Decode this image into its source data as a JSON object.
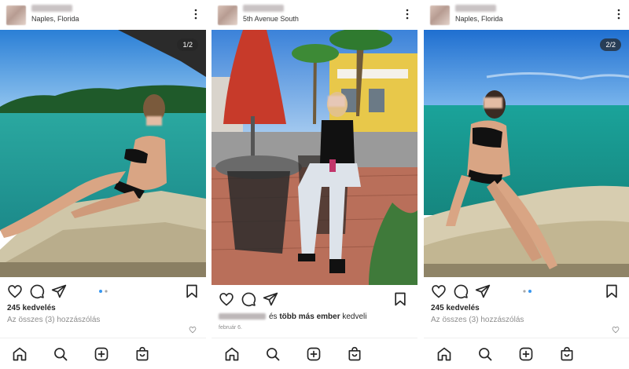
{
  "posts": [
    {
      "location": "Naples, Florida",
      "badge": "1/2",
      "likes": "245 kedvelés",
      "comments": "Az összes (3) hozzászólás"
    },
    {
      "location": "5th Avenue South",
      "likes_suffix": "és ",
      "likes_others": "több más ember",
      "likes_end": " kedveli",
      "date": "február 6."
    },
    {
      "location": "Naples, Florida",
      "badge": "2/2",
      "likes": "245 kedvelés",
      "comments": "Az összes (3) hozzászólás"
    }
  ],
  "icons": {
    "more": "more-vertical-icon",
    "like": "heart-icon",
    "comment": "comment-icon",
    "share": "send-icon",
    "save": "bookmark-icon",
    "home": "home-icon",
    "search": "search-icon",
    "create": "plus-square-icon",
    "shop": "shopping-bag-icon"
  },
  "colors": {
    "carousel_active_dot": "#3897f0",
    "carousel_inactive_dot": "#a8a8a8",
    "muted_text": "#8e8e8e"
  }
}
